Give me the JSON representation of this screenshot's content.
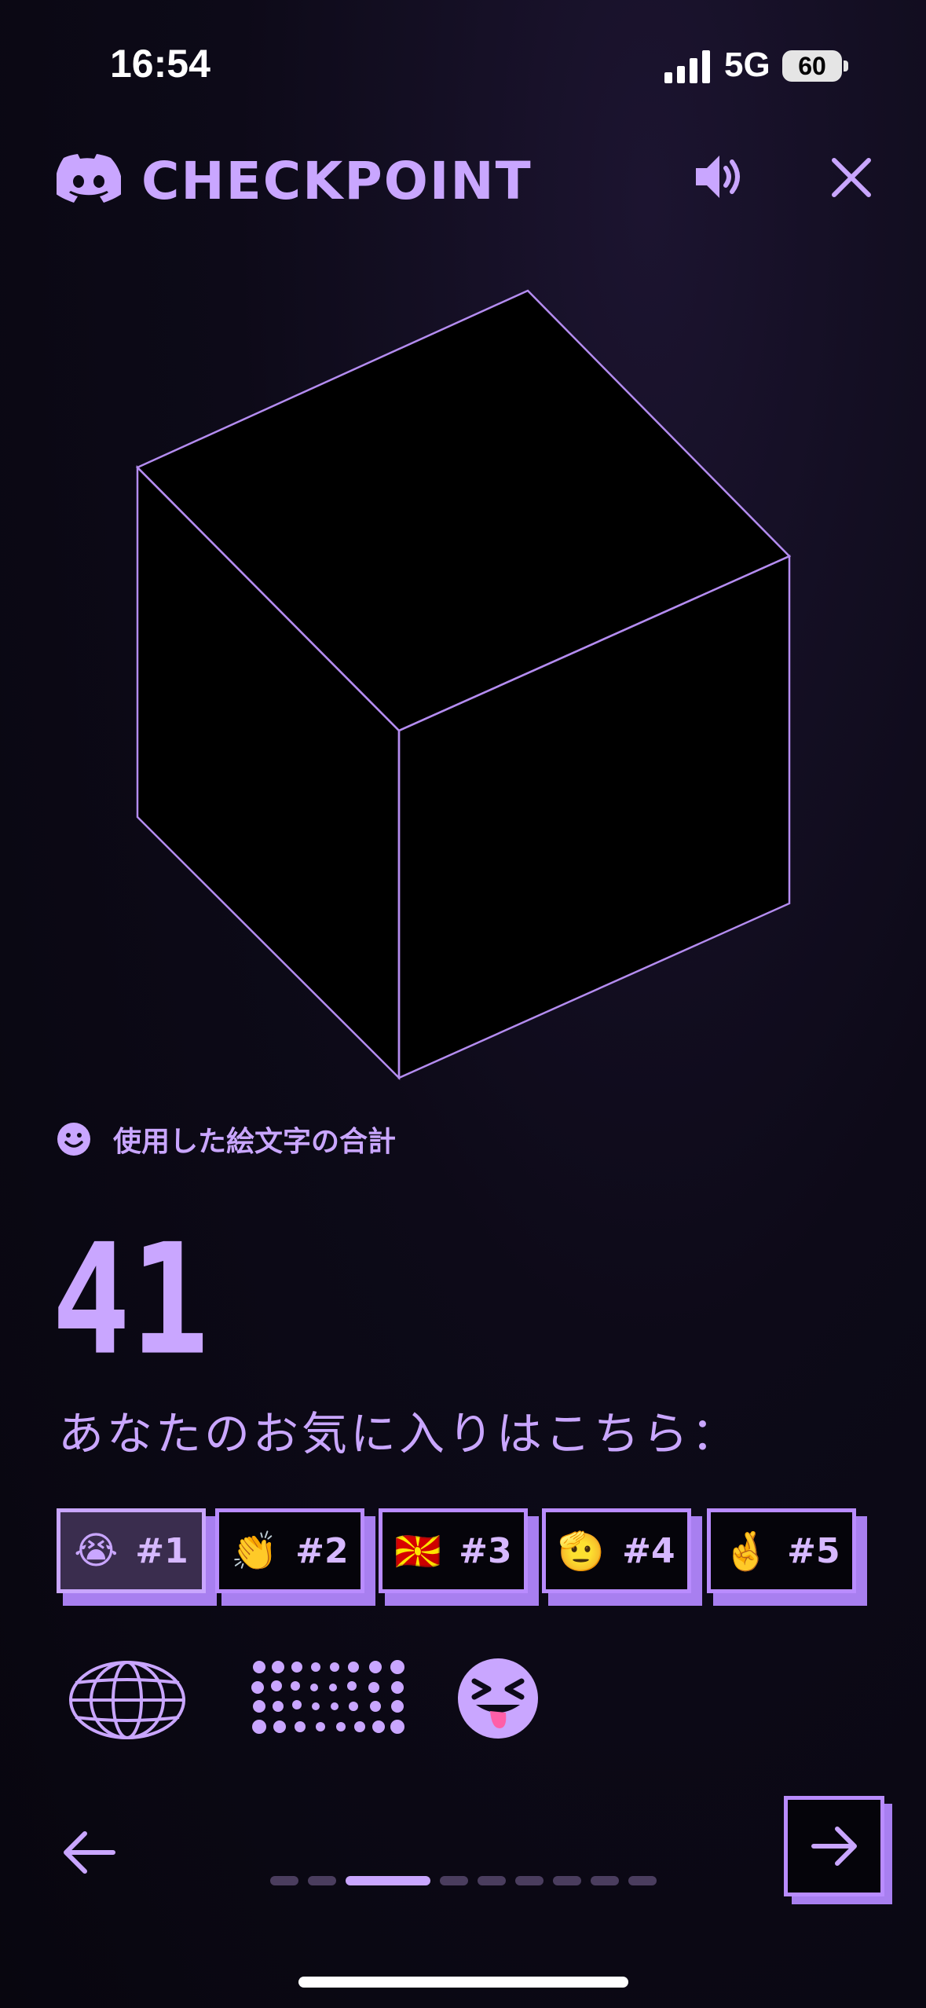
{
  "status_bar": {
    "time": "16:54",
    "network": "5G",
    "battery": "60"
  },
  "header": {
    "title": "CHECKPOINT"
  },
  "stat": {
    "label": "使用した絵文字の合計",
    "value": "41"
  },
  "favorites": {
    "label": "あなたのお気に入りはこちら：",
    "items": [
      {
        "emoji": "😭",
        "rank": "#1",
        "selected": true
      },
      {
        "emoji": "👏",
        "rank": "#2",
        "selected": false
      },
      {
        "emoji": "🇲🇰",
        "rank": "#3",
        "selected": false
      },
      {
        "emoji": "🫡",
        "rank": "#4",
        "selected": false
      },
      {
        "emoji": "🤞",
        "rank": "#5",
        "selected": false
      }
    ]
  },
  "cube_emoji": "😭",
  "pagination": {
    "total": 10,
    "current": 3
  },
  "colors": {
    "accent": "#c9a6ff",
    "accent_shadow": "#a87ff0",
    "background": "#0d0a18"
  }
}
